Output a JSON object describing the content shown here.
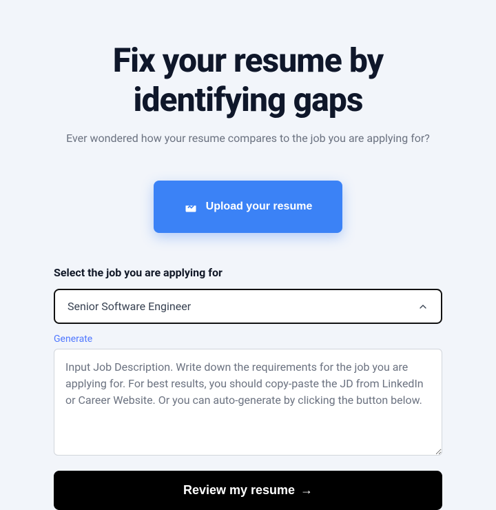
{
  "hero": {
    "title": "Fix your resume by identifying gaps",
    "subtitle": "Ever wondered how your resume compares to the job you are applying for?"
  },
  "upload": {
    "button_label": "Upload your resume"
  },
  "job_select": {
    "label": "Select the job you are applying for",
    "value": "Senior Software Engineer"
  },
  "generate": {
    "link_label": "Generate",
    "placeholder": "Input Job Description. Write down the requirements for the job you are applying for. For best results, you should copy-paste the JD from LinkedIn or Career Website. Or you can auto-generate by clicking the button below."
  },
  "review": {
    "button_label": "Review my resume",
    "arrow": "→"
  }
}
